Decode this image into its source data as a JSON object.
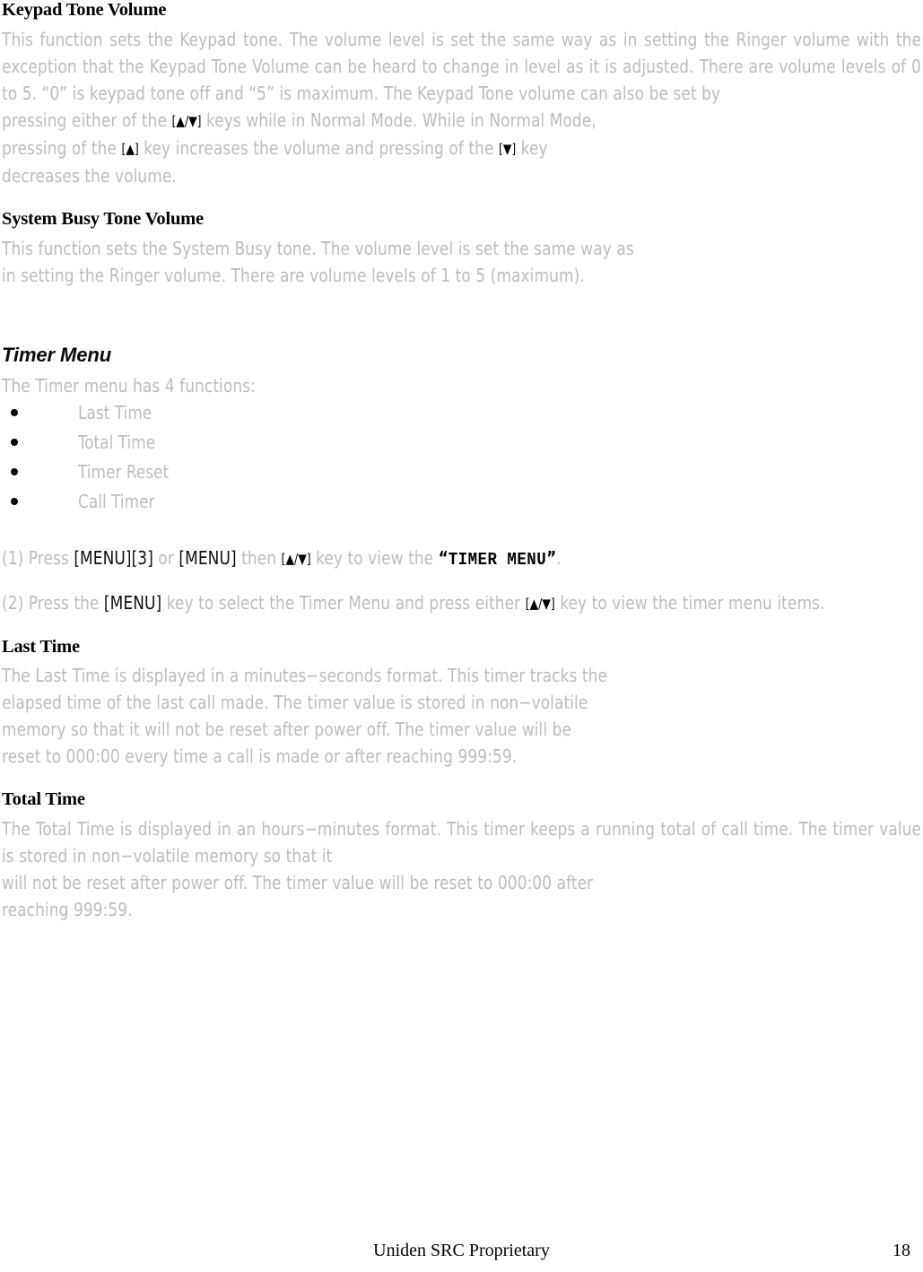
{
  "document": {
    "footer": {
      "center_text": "Uniden SRC Proprietary",
      "page_number": "18"
    }
  },
  "sections": {
    "keypad_tone_volume": {
      "heading": "Keypad Tone Volume",
      "paragraph_1": "This function sets the Keypad tone. The volume level is set the same way as in setting the Ringer volume with the exception that the Keypad Tone Volume can be heard to change in level as it is adjusted. There are volume levels of 0 to 5.  “0” is keypad tone off and “5” is maximum. The Keypad Tone volume can also be set by",
      "line_2_a": "pressing either of the ",
      "line_2_key": "[▲/▼]",
      "line_2_b": " keys while in Normal Mode. While in Normal Mode,",
      "line_3_a": "pressing of the ",
      "line_3_key_up": "[▲]",
      "line_3_b": " key increases the volume and pressing of the ",
      "line_3_key_down": "[▼]",
      "line_3_c": " key",
      "line_4": "decreases the volume."
    },
    "system_busy_tone_volume": {
      "heading": "System Busy Tone Volume",
      "line_1": "This function sets the System Busy tone. The volume level is set the same way as",
      "line_2": "in setting the Ringer volume. There are volume levels of 1 to 5 (maximum)."
    },
    "timer_menu": {
      "heading": "Timer Menu",
      "intro": "The Timer menu has 4 functions:",
      "items": [
        "Last Time",
        "Total Time",
        "Timer Reset",
        "Call Timer"
      ],
      "step_1": {
        "number": "(1)",
        "text_a": "  Press ",
        "key_menu_3": "[MENU][3]",
        "text_b": " or ",
        "key_menu": "[MENU]",
        "text_c": " then  ",
        "key_updown": "[▲/▼]",
        "text_d": " key to view the ",
        "open_quote": "“",
        "emphasis": "TIMER MENU",
        "close_quote": "”",
        "text_e": "."
      },
      "step_2": {
        "number": "(2)",
        "text_a": "  Press the ",
        "key_menu": "[MENU]",
        "text_b": " key to select the Timer Menu and press either ",
        "key_updown": "[▲/▼]",
        "text_c": " key to view the timer menu items."
      }
    },
    "last_time": {
      "heading": "Last Time",
      "line_1": "The Last Time is displayed in a minutes−seconds format. This timer tracks the",
      "line_2": "elapsed time of the last call made. The timer value is stored in non−volatile",
      "line_3": "memory so that it will not be reset after power off.  The timer value will be",
      "line_4": "reset to 000:00 every time a call is made or after reaching 999:59."
    },
    "total_time": {
      "heading": "Total Time",
      "paragraph": "The Total Time is displayed in an hours−minutes format. This timer keeps a running total of call time. The timer value is stored in non−volatile memory so that it",
      "line_3": "will not be reset after power off. The timer value will be reset to 000:00 after",
      "line_4": "reaching 999:59."
    }
  }
}
